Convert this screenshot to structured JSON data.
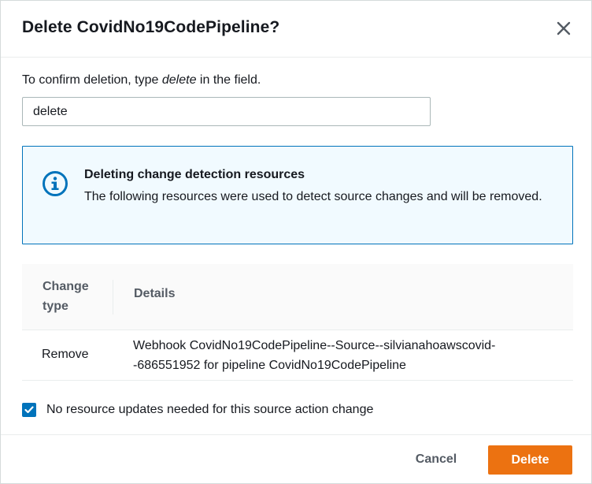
{
  "dialog": {
    "title": "Delete CovidNo19CodePipeline?",
    "close_icon": "close-icon"
  },
  "confirm": {
    "prompt_before": "To confirm deletion, type ",
    "prompt_keyword": "delete",
    "prompt_after": " in the field.",
    "input_value": "delete"
  },
  "alert": {
    "icon": "info-icon",
    "title": "Deleting change detection resources",
    "body": "The following resources were used to detect source changes and will be removed.",
    "accent_color": "#0073bb",
    "background_color": "#f1faff"
  },
  "table": {
    "headers": [
      "Change type",
      "Details"
    ],
    "rows": [
      {
        "change_type": "Remove",
        "details": "Webhook CovidNo19CodePipeline--Source--silvianahoawscovid--686551952 for pipeline CovidNo19CodePipeline"
      }
    ]
  },
  "checkbox": {
    "checked": true,
    "label": "No resource updates needed for this source action change"
  },
  "footer": {
    "cancel_label": "Cancel",
    "delete_label": "Delete",
    "primary_color": "#ec7211"
  }
}
